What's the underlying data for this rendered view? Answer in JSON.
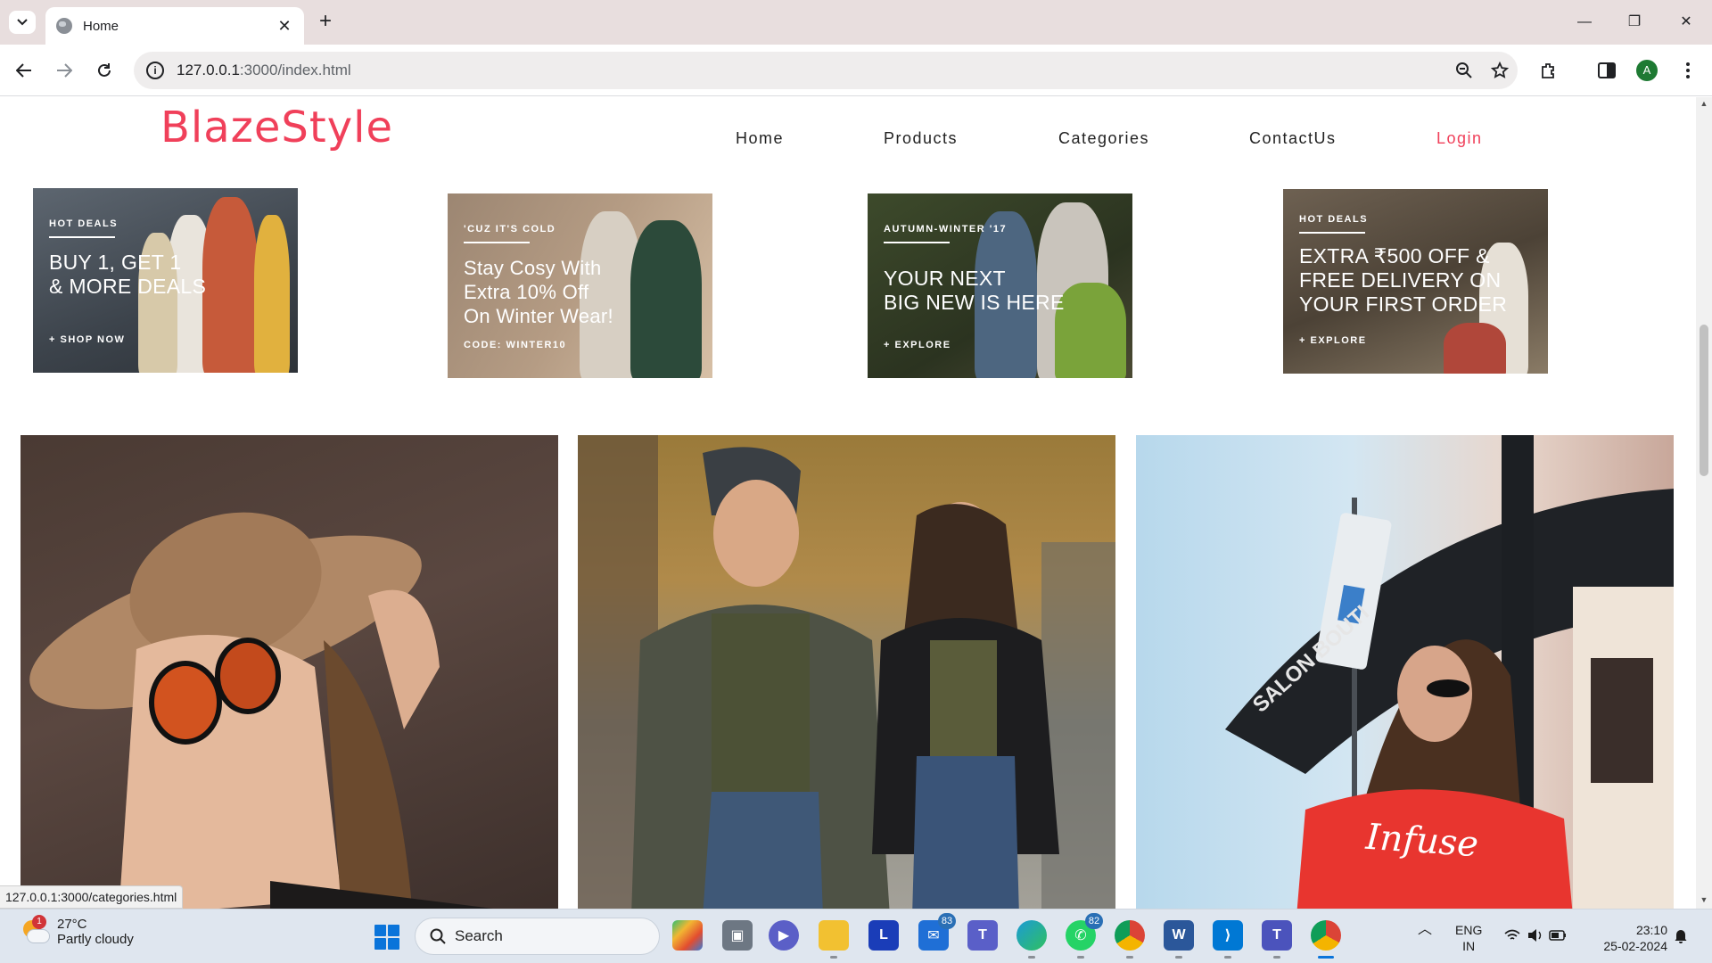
{
  "browser": {
    "tab_title": "Home",
    "new_tab": "+",
    "url_host": "127.0.0.1",
    "url_rest": ":3000/index.html",
    "profile_initial": "A",
    "window_controls": {
      "minimize": "—",
      "restore": "❐",
      "close": "✕"
    }
  },
  "site": {
    "logo": "BlazeStyle",
    "nav": {
      "home": "Home",
      "products": "Products",
      "categories": "Categories",
      "contact": "ContactUs",
      "login": "Login"
    },
    "accent_color": "#f0405a"
  },
  "banners": [
    {
      "tag": "HOT DEALS",
      "heading_line1": "BUY 1, GET 1",
      "heading_line2": "& MORE DEALS",
      "cta": "+ SHOP NOW"
    },
    {
      "tag": "'CUZ IT'S COLD",
      "heading_line1": "Stay Cosy With",
      "heading_line2": "Extra 10% Off",
      "heading_line3": "On Winter Wear!",
      "cta": "CODE: WINTER10"
    },
    {
      "tag": "AUTUMN-WINTER '17",
      "heading_line1": "YOUR NEXT",
      "heading_line2": "BIG NEW IS HERE",
      "cta": "+ EXPLORE"
    },
    {
      "tag": "HOT DEALS",
      "heading_line1": "EXTRA ₹500 OFF &",
      "heading_line2": "FREE DELIVERY ON",
      "heading_line3": "YOUR FIRST ORDER",
      "cta": "+ EXPLORE"
    }
  ],
  "photos": {
    "shirt_text": "Infuse",
    "sign_text": "SALON BOUTI"
  },
  "status_bar_url": "127.0.0.1:3000/categories.html",
  "taskbar": {
    "weather_temp": "27°C",
    "weather_desc": "Partly cloudy",
    "weather_badge": "1",
    "search_label": "Search",
    "mail_badge": "83",
    "whatsapp_badge": "82",
    "lang_line1": "ENG",
    "lang_line2": "IN",
    "time": "23:10",
    "date": "25-02-2024"
  }
}
